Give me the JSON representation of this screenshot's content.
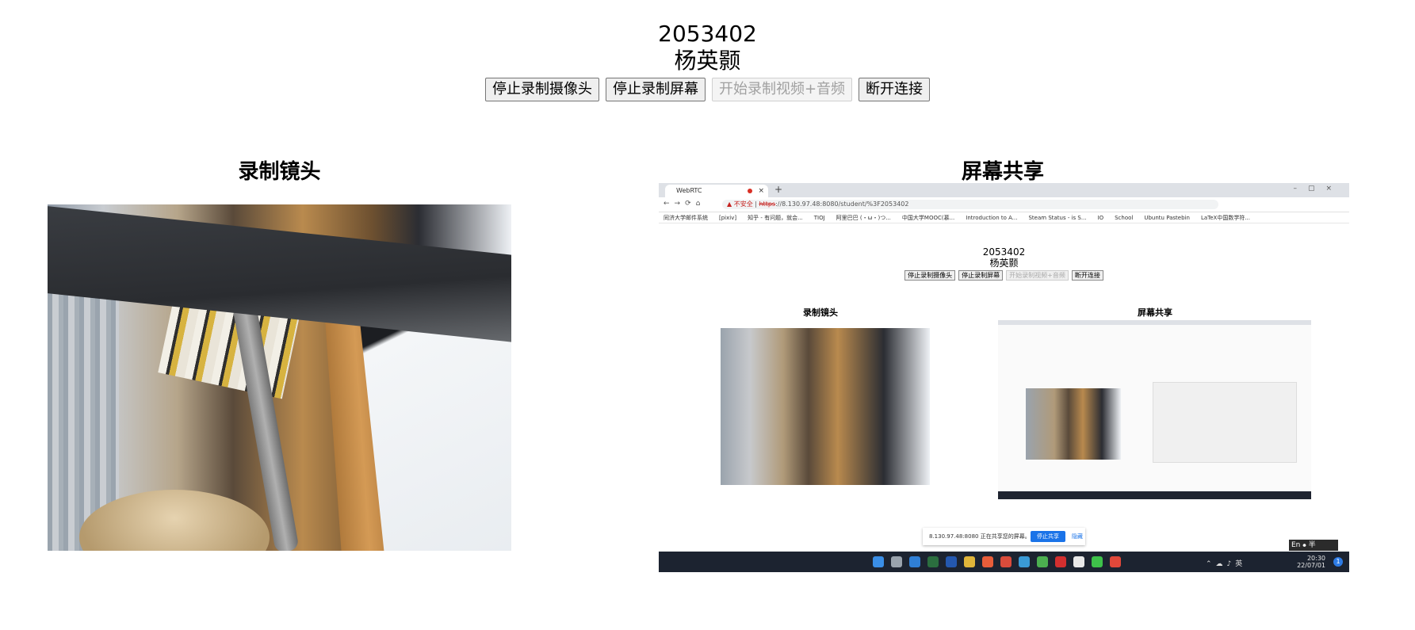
{
  "header": {
    "student_id": "2053402",
    "student_name": "杨英颢"
  },
  "controls": {
    "stop_camera": "停止录制摄像头",
    "stop_screen": "停止录制屏幕",
    "start_av": "开始录制视频+音频",
    "disconnect": "断开连接"
  },
  "sections": {
    "camera_title": "录制镜头",
    "screen_title": "屏幕共享"
  },
  "shared_screen": {
    "tab_title": "WebRTC",
    "url_warning": "不安全",
    "url_https": "https",
    "url_rest": "://8.130.97.48:8080/student/%3F2053402",
    "bookmarks": [
      "同济大学邮件系统",
      "[pixiv]",
      "知乎 - 有问题，就会...",
      "TIOJ",
      "阿里巴巴 (・ω・)つ...",
      "中国大学MOOC(慕...",
      "Introduction to A...",
      "Steam Status - is S...",
      "IO",
      "School",
      "Ubuntu Pastebin",
      "LaTeX中国数学符..."
    ],
    "inner": {
      "student_id": "2053402",
      "student_name": "杨英颢",
      "buttons": [
        "停止录制摄像头",
        "停止录制屏幕",
        "开始录制视频+音频",
        "断开连接"
      ],
      "camera_title": "录制镜头",
      "screen_title": "屏幕共享"
    },
    "share_notice": {
      "text": "8.130.97.48:8080 正在共享您的屏幕。",
      "stop_label": "停止共享",
      "hide_label": "隐藏"
    },
    "ime": "En ⦁ 半",
    "taskbar": {
      "time": "20:30",
      "date": "22/07/01",
      "notification_count": "1",
      "tray_lang": "英"
    }
  },
  "colors": {
    "accent_blue": "#1a73e8",
    "taskbar": "#1c2330",
    "record_red": "#d93025"
  }
}
